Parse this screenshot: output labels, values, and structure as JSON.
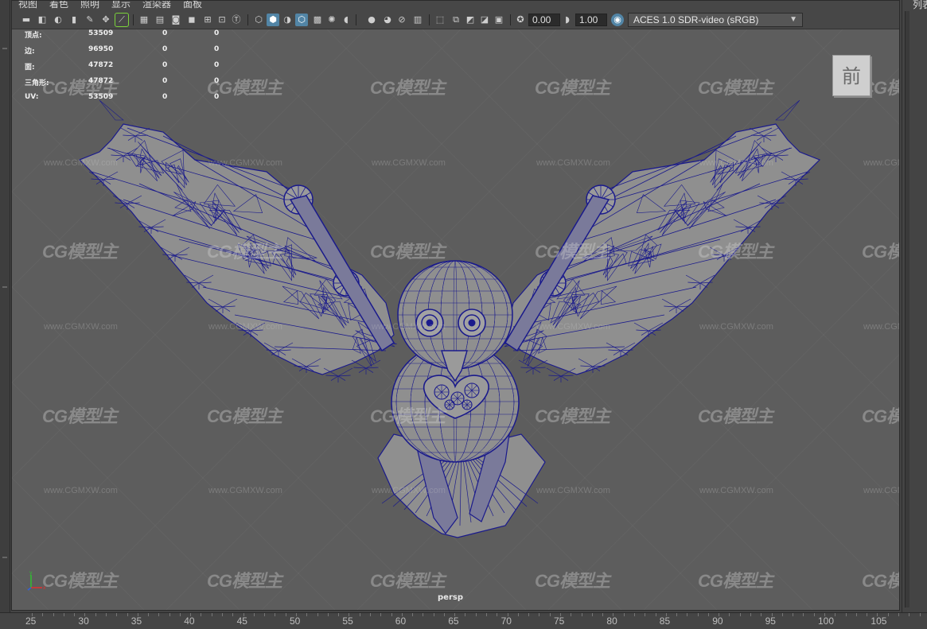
{
  "menubar": {
    "items": [
      "视图",
      "着色",
      "照明",
      "显示",
      "渲染器",
      "面板"
    ]
  },
  "toolbar": {
    "exposure_value": "0.00",
    "gamma_value": "1.00",
    "color_space": "ACES 1.0 SDR-video (sRGB)"
  },
  "right_panel": {
    "label": "列表"
  },
  "hud": {
    "rows": [
      {
        "label": "顶点:",
        "total": "53509",
        "sel": "0",
        "comp": "0"
      },
      {
        "label": "边:",
        "total": "96950",
        "sel": "0",
        "comp": "0"
      },
      {
        "label": "面:",
        "total": "47872",
        "sel": "0",
        "comp": "0"
      },
      {
        "label": "三角形:",
        "total": "47872",
        "sel": "0",
        "comp": "0"
      },
      {
        "label": "UV:",
        "total": "53509",
        "sel": "0",
        "comp": "0"
      }
    ]
  },
  "viewcube": {
    "face_label": "前"
  },
  "camera_label": "persp",
  "watermark": {
    "logo_text": "CG模型主",
    "url_text": "www.CGMXW.com"
  },
  "timeline": {
    "frames": [
      "25",
      "30",
      "35",
      "40",
      "45",
      "50",
      "55",
      "60",
      "65",
      "70",
      "75",
      "80",
      "85",
      "90",
      "95",
      "100",
      "105"
    ]
  },
  "colors": {
    "viewport_bg": "#5d5d5d",
    "wireframe": "#1a1a8c",
    "selection_blue": "#5285a6",
    "axis_x": "#e03030",
    "axis_y": "#30c030",
    "axis_z": "#3060e0"
  },
  "icons": {
    "toolbar": [
      "camera-icon",
      "camera-attr-icon",
      "bookmark-icon",
      "image-plane-icon",
      "2d-pan-icon",
      "grease-pencil-icon",
      "grid-icon",
      "film-gate-icon",
      "resolution-gate-icon",
      "gate-mask-icon",
      "field-chart-icon",
      "safe-action-icon",
      "safe-title-icon",
      "wireframe-icon",
      "smooth-shade-icon",
      "wireframe-on-shaded-icon",
      "textured-icon",
      "use-all-lights-icon",
      "shadows-icon",
      "screen-space-ao-icon",
      "motion-blur-icon",
      "multisample-aa-icon",
      "depth-of-field-icon",
      "isolate-select-icon",
      "xray-icon",
      "xray-joints-icon",
      "backface-culling-icon",
      "exposure-icon",
      "gamma-icon",
      "color-management-icon"
    ]
  }
}
